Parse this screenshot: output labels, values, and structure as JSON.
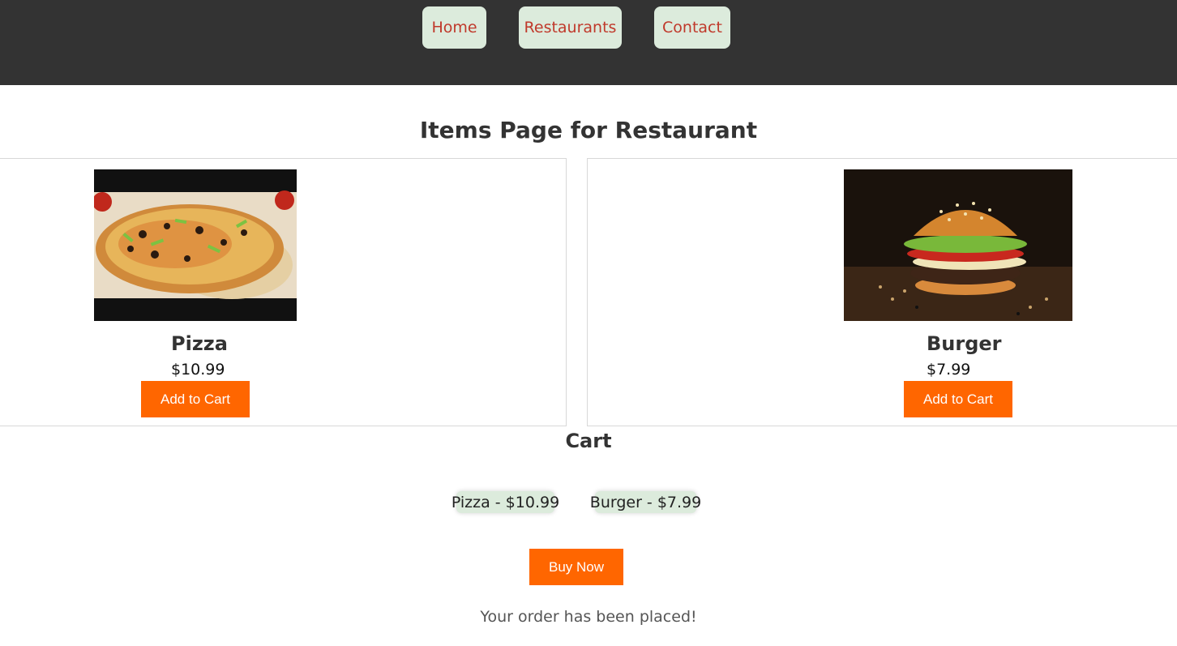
{
  "nav": {
    "home": "Home",
    "restaurants": "Restaurants",
    "contact": "Contact"
  },
  "page_title": "Items Page for Restaurant",
  "items": [
    {
      "name": "Pizza",
      "price": "$10.99",
      "button": "Add to Cart",
      "image": "pizza-photo"
    },
    {
      "name": "Burger",
      "price": "$7.99",
      "button": "Add to Cart",
      "image": "burger-photo"
    }
  ],
  "cart": {
    "title": "Cart",
    "entries": [
      "Pizza - $10.99",
      "Burger - $7.99"
    ],
    "buy_button": "Buy Now",
    "message": "Your order has been placed!"
  },
  "colors": {
    "header_bg": "#333333",
    "nav_button_bg": "#dcebdc",
    "nav_text": "#c0392b",
    "action_button": "#ff6600"
  }
}
